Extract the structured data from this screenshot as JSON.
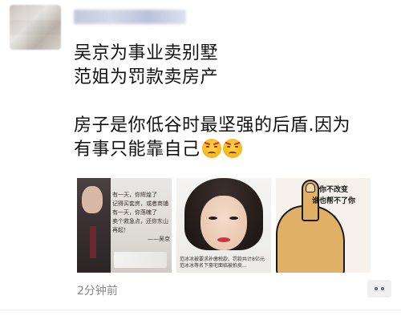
{
  "post": {
    "avatar": "blurred-avatar",
    "username": "",
    "lines": [
      "吴京为事业卖别墅",
      "范姐为罚款卖房产",
      "",
      "房子是你低谷时最坚强的后盾.因为",
      "有事只能靠自己"
    ],
    "emoji": [
      "angry-face-emoji",
      "angry-face-emoji"
    ],
    "images": [
      {
        "name": "quote-image",
        "quote_lines": [
          "有一天，你辉煌了",
          "记得买套房，或者商铺",
          "有一天，你落魄了",
          "卖个救急点，还你东山再起！",
          "——吴京"
        ],
        "highlight": [
          "商铺",
          "东山再起"
        ]
      },
      {
        "name": "portrait-image",
        "caption": [
          "范冰冰被要求补缴税款、罚款共计8亿元",
          "范冰冰等名下豪宅面临被拍卖..."
        ],
        "highlight": "8亿元"
      },
      {
        "name": "meme-image",
        "text": [
          "你不改变",
          "谁也帮不了你"
        ]
      }
    ],
    "timestamp": "2分钟前"
  },
  "colors": {
    "link_blue": "#576b95",
    "timestamp_gray": "#8a8a8a",
    "more_bg": "#f0f0f0"
  }
}
